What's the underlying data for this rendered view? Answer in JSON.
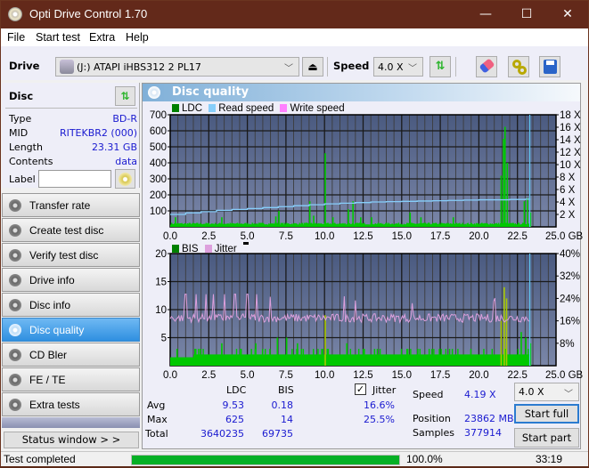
{
  "window": {
    "title": "Opti Drive Control 1.70",
    "controls": {
      "minimize": "—",
      "maximize": "☐",
      "close": "✕"
    }
  },
  "menu": [
    "File",
    "Start test",
    "Extra",
    "Help"
  ],
  "toolbar": {
    "drive_label": "Drive",
    "drive_value": "(J:)  ATAPI iHBS312  2 PL17",
    "speed_label": "Speed",
    "speed_value": "4.0 X",
    "icons": [
      "drive-icon",
      "eject-icon",
      "refresh-icon",
      "eraser-icon",
      "settings-gears-icon",
      "save-icon"
    ]
  },
  "disc": {
    "header": "Disc",
    "fields": [
      {
        "label": "Type",
        "value": "BD-R"
      },
      {
        "label": "MID",
        "value": "RITEKBR2 (000)"
      },
      {
        "label": "Length",
        "value": "23.31 GB"
      },
      {
        "label": "Contents",
        "value": "data"
      }
    ],
    "label_field": {
      "label": "Label",
      "value": ""
    }
  },
  "nav": [
    {
      "label": "Transfer rate",
      "active": false
    },
    {
      "label": "Create test disc",
      "active": false
    },
    {
      "label": "Verify test disc",
      "active": false
    },
    {
      "label": "Drive info",
      "active": false
    },
    {
      "label": "Disc info",
      "active": false
    },
    {
      "label": "Disc quality",
      "active": true
    },
    {
      "label": "CD Bler",
      "active": false
    },
    {
      "label": "FE / TE",
      "active": false
    },
    {
      "label": "Extra tests",
      "active": false
    }
  ],
  "status_window_button": "Status window > >",
  "panel": {
    "title": "Disc quality",
    "top_legend": [
      {
        "label": "LDC",
        "color": "#008000"
      },
      {
        "label": "Read speed",
        "color": "#87cefa"
      },
      {
        "label": "Write speed",
        "color": "#ff80ff"
      }
    ],
    "bottom_legend": [
      {
        "label": "BIS",
        "color": "#008000"
      },
      {
        "label": "Jitter",
        "color": "#dda0dd"
      }
    ]
  },
  "chart_data": [
    {
      "type": "bar",
      "title": "LDC / Read speed",
      "xlabel": "GB",
      "x_ticks": [
        "0.0",
        "2.5",
        "5.0",
        "7.5",
        "10.0",
        "12.5",
        "15.0",
        "17.5",
        "20.0",
        "22.5",
        "25.0 GB"
      ],
      "xlim": [
        0,
        25
      ],
      "y_left_ticks": [
        "100",
        "200",
        "300",
        "400",
        "500",
        "600",
        "700"
      ],
      "ylim_left": [
        0,
        700
      ],
      "y_right_ticks": [
        "2 X",
        "4 X",
        "6 X",
        "8 X",
        "10 X",
        "12 X",
        "14 X",
        "16 X",
        "18 X"
      ],
      "ylim_right": [
        0,
        18
      ],
      "grid": true,
      "series": [
        {
          "name": "LDC",
          "color": "#00c800",
          "baseline": 20,
          "spikes": [
            {
              "x": 0.3,
              "y": 60
            },
            {
              "x": 3.3,
              "y": 60
            },
            {
              "x": 6.8,
              "y": 65
            },
            {
              "x": 7.0,
              "y": 100
            },
            {
              "x": 9.0,
              "y": 160
            },
            {
              "x": 9.25,
              "y": 70
            },
            {
              "x": 10.0,
              "y": 460
            },
            {
              "x": 10.5,
              "y": 60
            },
            {
              "x": 11.5,
              "y": 110
            },
            {
              "x": 11.8,
              "y": 160
            },
            {
              "x": 12.3,
              "y": 60
            },
            {
              "x": 13.0,
              "y": 60
            },
            {
              "x": 15.5,
              "y": 90
            },
            {
              "x": 16.2,
              "y": 60
            },
            {
              "x": 18.3,
              "y": 60
            },
            {
              "x": 21.4,
              "y": 320
            },
            {
              "x": 21.55,
              "y": 550
            },
            {
              "x": 21.65,
              "y": 625
            },
            {
              "x": 21.8,
              "y": 400
            },
            {
              "x": 22.9,
              "y": 160
            },
            {
              "x": 23.1,
              "y": 180
            },
            {
              "x": 23.3,
              "y": 90
            }
          ]
        },
        {
          "name": "Read speed",
          "color": "#87cefa",
          "unit": "X",
          "points": [
            [
              0,
              2.0
            ],
            [
              1.0,
              2.25
            ],
            [
              2.0,
              2.45
            ],
            [
              3.0,
              2.65
            ],
            [
              4.0,
              2.8
            ],
            [
              5.0,
              2.95
            ],
            [
              6.0,
              3.1
            ],
            [
              7.0,
              3.25
            ],
            [
              8.0,
              3.4
            ],
            [
              9.0,
              3.55
            ],
            [
              10.0,
              3.7
            ],
            [
              11.0,
              3.8
            ],
            [
              12.0,
              3.9
            ],
            [
              13.0,
              4.0
            ],
            [
              14.0,
              4.05
            ],
            [
              15.0,
              4.1
            ],
            [
              16.0,
              4.15
            ],
            [
              17.0,
              4.2
            ],
            [
              18.0,
              4.25
            ],
            [
              19.0,
              4.3
            ],
            [
              20.0,
              4.35
            ],
            [
              21.0,
              4.35
            ],
            [
              22.0,
              4.4
            ],
            [
              23.0,
              4.45
            ],
            [
              23.31,
              4.5
            ]
          ]
        }
      ],
      "position_marker_gb": 23.3
    },
    {
      "type": "bar",
      "title": "BIS / Jitter",
      "xlabel": "GB",
      "x_ticks": [
        "0.0",
        "2.5",
        "5.0",
        "7.5",
        "10.0",
        "12.5",
        "15.0",
        "17.5",
        "20.0",
        "22.5",
        "25.0 GB"
      ],
      "xlim": [
        0,
        25
      ],
      "y_left_ticks": [
        "5",
        "10",
        "15",
        "20"
      ],
      "ylim_left": [
        0,
        20
      ],
      "y_right_ticks": [
        "8%",
        "16%",
        "24%",
        "32%",
        "40%"
      ],
      "ylim_right": [
        0,
        40
      ],
      "grid": true,
      "series": [
        {
          "name": "BIS",
          "color": "#00c800",
          "baseline": 2,
          "spikes": [
            {
              "x": 0.4,
              "y": 3
            },
            {
              "x": 3.3,
              "y": 4
            },
            {
              "x": 5.5,
              "y": 4
            },
            {
              "x": 6.9,
              "y": 5
            },
            {
              "x": 7.5,
              "y": 5
            },
            {
              "x": 8.2,
              "y": 4
            },
            {
              "x": 10.0,
              "y": 9
            },
            {
              "x": 11.4,
              "y": 4
            },
            {
              "x": 16.0,
              "y": 3
            },
            {
              "x": 21.4,
              "y": 8
            },
            {
              "x": 21.6,
              "y": 14
            },
            {
              "x": 21.75,
              "y": 12
            },
            {
              "x": 22.7,
              "y": 6
            },
            {
              "x": 23.0,
              "y": 5
            },
            {
              "x": 23.3,
              "y": 4
            }
          ]
        },
        {
          "name": "Jitter",
          "color": "#dda0dd",
          "unit": "%",
          "avg": 16.6,
          "max": 25.5,
          "range": [
            15.0,
            25.5
          ],
          "peaks_gb": [
            1.0,
            1.7,
            2.3,
            2.8,
            3.5,
            4.2,
            5.0,
            5.6,
            6.5,
            11.3,
            12.0,
            15.7,
            21.0
          ]
        }
      ],
      "position_marker_gb": 23.3
    }
  ],
  "stats": {
    "headers": [
      "LDC",
      "BIS"
    ],
    "rows": [
      {
        "label": "Avg",
        "ldc": "9.53",
        "bis": "0.18",
        "jitter": "16.6%"
      },
      {
        "label": "Max",
        "ldc": "625",
        "bis": "14",
        "jitter": "25.5%"
      },
      {
        "label": "Total",
        "ldc": "3640235",
        "bis": "69735",
        "jitter": ""
      }
    ],
    "jitter_label": "Jitter",
    "jitter_checked": true,
    "speed_label": "Speed",
    "speed_value": "4.19 X",
    "position_label": "Position",
    "position_value": "23862 MB",
    "samples_label": "Samples",
    "samples_value": "377914",
    "speed_select": "4.0 X",
    "start_full": "Start full",
    "start_part": "Start part"
  },
  "statusbar": {
    "text": "Test completed",
    "progress": 100.0,
    "progress_text": "100.0%",
    "time": "33:19"
  }
}
